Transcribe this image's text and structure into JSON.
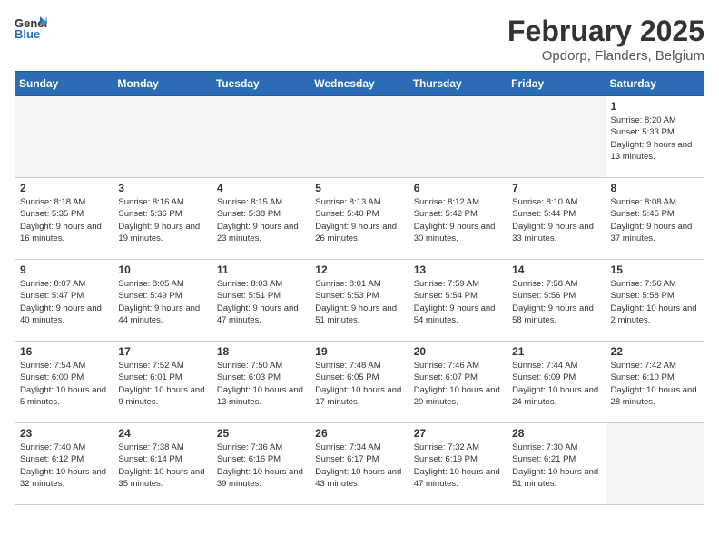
{
  "logo": {
    "general": "General",
    "blue": "Blue"
  },
  "header": {
    "month": "February 2025",
    "location": "Opdorp, Flanders, Belgium"
  },
  "weekdays": [
    "Sunday",
    "Monday",
    "Tuesday",
    "Wednesday",
    "Thursday",
    "Friday",
    "Saturday"
  ],
  "weeks": [
    [
      {
        "day": "",
        "info": ""
      },
      {
        "day": "",
        "info": ""
      },
      {
        "day": "",
        "info": ""
      },
      {
        "day": "",
        "info": ""
      },
      {
        "day": "",
        "info": ""
      },
      {
        "day": "",
        "info": ""
      },
      {
        "day": "1",
        "info": "Sunrise: 8:20 AM\nSunset: 5:33 PM\nDaylight: 9 hours and 13 minutes."
      }
    ],
    [
      {
        "day": "2",
        "info": "Sunrise: 8:18 AM\nSunset: 5:35 PM\nDaylight: 9 hours and 16 minutes."
      },
      {
        "day": "3",
        "info": "Sunrise: 8:16 AM\nSunset: 5:36 PM\nDaylight: 9 hours and 19 minutes."
      },
      {
        "day": "4",
        "info": "Sunrise: 8:15 AM\nSunset: 5:38 PM\nDaylight: 9 hours and 23 minutes."
      },
      {
        "day": "5",
        "info": "Sunrise: 8:13 AM\nSunset: 5:40 PM\nDaylight: 9 hours and 26 minutes."
      },
      {
        "day": "6",
        "info": "Sunrise: 8:12 AM\nSunset: 5:42 PM\nDaylight: 9 hours and 30 minutes."
      },
      {
        "day": "7",
        "info": "Sunrise: 8:10 AM\nSunset: 5:44 PM\nDaylight: 9 hours and 33 minutes."
      },
      {
        "day": "8",
        "info": "Sunrise: 8:08 AM\nSunset: 5:45 PM\nDaylight: 9 hours and 37 minutes."
      }
    ],
    [
      {
        "day": "9",
        "info": "Sunrise: 8:07 AM\nSunset: 5:47 PM\nDaylight: 9 hours and 40 minutes."
      },
      {
        "day": "10",
        "info": "Sunrise: 8:05 AM\nSunset: 5:49 PM\nDaylight: 9 hours and 44 minutes."
      },
      {
        "day": "11",
        "info": "Sunrise: 8:03 AM\nSunset: 5:51 PM\nDaylight: 9 hours and 47 minutes."
      },
      {
        "day": "12",
        "info": "Sunrise: 8:01 AM\nSunset: 5:53 PM\nDaylight: 9 hours and 51 minutes."
      },
      {
        "day": "13",
        "info": "Sunrise: 7:59 AM\nSunset: 5:54 PM\nDaylight: 9 hours and 54 minutes."
      },
      {
        "day": "14",
        "info": "Sunrise: 7:58 AM\nSunset: 5:56 PM\nDaylight: 9 hours and 58 minutes."
      },
      {
        "day": "15",
        "info": "Sunrise: 7:56 AM\nSunset: 5:58 PM\nDaylight: 10 hours and 2 minutes."
      }
    ],
    [
      {
        "day": "16",
        "info": "Sunrise: 7:54 AM\nSunset: 6:00 PM\nDaylight: 10 hours and 5 minutes."
      },
      {
        "day": "17",
        "info": "Sunrise: 7:52 AM\nSunset: 6:01 PM\nDaylight: 10 hours and 9 minutes."
      },
      {
        "day": "18",
        "info": "Sunrise: 7:50 AM\nSunset: 6:03 PM\nDaylight: 10 hours and 13 minutes."
      },
      {
        "day": "19",
        "info": "Sunrise: 7:48 AM\nSunset: 6:05 PM\nDaylight: 10 hours and 17 minutes."
      },
      {
        "day": "20",
        "info": "Sunrise: 7:46 AM\nSunset: 6:07 PM\nDaylight: 10 hours and 20 minutes."
      },
      {
        "day": "21",
        "info": "Sunrise: 7:44 AM\nSunset: 6:09 PM\nDaylight: 10 hours and 24 minutes."
      },
      {
        "day": "22",
        "info": "Sunrise: 7:42 AM\nSunset: 6:10 PM\nDaylight: 10 hours and 28 minutes."
      }
    ],
    [
      {
        "day": "23",
        "info": "Sunrise: 7:40 AM\nSunset: 6:12 PM\nDaylight: 10 hours and 32 minutes."
      },
      {
        "day": "24",
        "info": "Sunrise: 7:38 AM\nSunset: 6:14 PM\nDaylight: 10 hours and 35 minutes."
      },
      {
        "day": "25",
        "info": "Sunrise: 7:36 AM\nSunset: 6:16 PM\nDaylight: 10 hours and 39 minutes."
      },
      {
        "day": "26",
        "info": "Sunrise: 7:34 AM\nSunset: 6:17 PM\nDaylight: 10 hours and 43 minutes."
      },
      {
        "day": "27",
        "info": "Sunrise: 7:32 AM\nSunset: 6:19 PM\nDaylight: 10 hours and 47 minutes."
      },
      {
        "day": "28",
        "info": "Sunrise: 7:30 AM\nSunset: 6:21 PM\nDaylight: 10 hours and 51 minutes."
      },
      {
        "day": "",
        "info": ""
      }
    ]
  ]
}
